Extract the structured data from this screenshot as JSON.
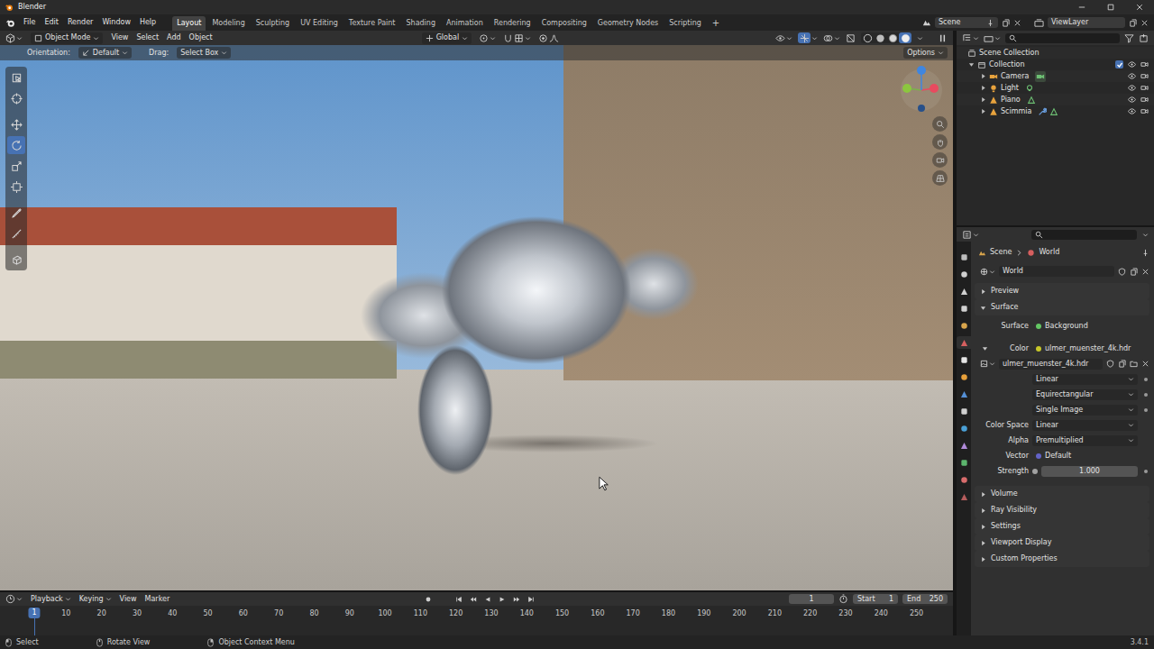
{
  "window": {
    "title": "Blender"
  },
  "topbar": {
    "menus": [
      "File",
      "Edit",
      "Render",
      "Window",
      "Help"
    ],
    "workspaces": [
      {
        "label": "Layout",
        "selected": true
      },
      {
        "label": "Modeling",
        "selected": false
      },
      {
        "label": "Sculpting",
        "selected": false
      },
      {
        "label": "UV Editing",
        "selected": false
      },
      {
        "label": "Texture Paint",
        "selected": false
      },
      {
        "label": "Shading",
        "selected": false
      },
      {
        "label": "Animation",
        "selected": false
      },
      {
        "label": "Rendering",
        "selected": false
      },
      {
        "label": "Compositing",
        "selected": false
      },
      {
        "label": "Geometry Nodes",
        "selected": false
      },
      {
        "label": "Scripting",
        "selected": false
      }
    ],
    "add_tab": "+",
    "scene": "Scene",
    "view_layer": "ViewLayer"
  },
  "viewport": {
    "mode": "Object Mode",
    "menus": [
      "View",
      "Select",
      "Add",
      "Object"
    ],
    "orientation": "Global",
    "gizmos_on": true,
    "shading_modes": [
      {
        "selected": false
      },
      {
        "selected": false
      },
      {
        "selected": false
      },
      {
        "selected": true
      }
    ],
    "tool_settings": {
      "orientation_label": "Orientation:",
      "orientation": "Default",
      "drag_label": "Drag:",
      "drag": "Select Box",
      "options": "Options"
    },
    "tools": [
      {
        "selected": false
      },
      {
        "selected": false
      },
      {
        "selected": false
      },
      {
        "selected": true
      },
      {
        "selected": false
      },
      {
        "selected": false
      },
      {
        "selected": false
      },
      {
        "selected": false
      },
      {
        "selected": false
      }
    ]
  },
  "outliner": {
    "root": "Scene Collection",
    "collection": {
      "name": "Collection",
      "checked": true,
      "expanded": true,
      "visible": true,
      "renderable": true
    },
    "items": [
      {
        "name": "Camera",
        "kind": "camera",
        "has_modifier": false,
        "visible": true,
        "renderable": true
      },
      {
        "name": "Light",
        "kind": "light",
        "has_modifier": false,
        "visible": true,
        "renderable": true
      },
      {
        "name": "Piano",
        "kind": "mesh",
        "has_modifier": false,
        "visible": true,
        "renderable": true
      },
      {
        "name": "Scimmia",
        "kind": "mesh",
        "has_modifier": true,
        "visible": true,
        "renderable": true
      }
    ]
  },
  "properties": {
    "tabs": [
      {
        "selected": false
      },
      {
        "selected": false
      },
      {
        "selected": false
      },
      {
        "selected": false
      },
      {
        "selected": false
      },
      {
        "selected": true
      },
      {
        "selected": false
      },
      {
        "selected": false
      },
      {
        "selected": false
      },
      {
        "selected": false
      },
      {
        "selected": false
      },
      {
        "selected": false
      },
      {
        "selected": false
      },
      {
        "selected": false
      },
      {
        "selected": false
      }
    ],
    "breadcrumb": [
      "Scene",
      "World"
    ],
    "world": "World",
    "sections": [
      {
        "label": "Preview",
        "expanded": false
      },
      {
        "label": "Surface",
        "expanded": true
      }
    ],
    "sockets_top": [
      {
        "label": "Surface",
        "value": "Background",
        "color": "#63c763",
        "expandable": false,
        "expanded": false
      },
      {
        "label": "Color",
        "value": "ulmer_muenster_4k.hdr",
        "color": "#c7c729",
        "expandable": true,
        "expanded": true
      }
    ],
    "image": "ulmer_muenster_4k.hdr",
    "image_options": [
      "Linear",
      "Equirectangular",
      "Single Image"
    ],
    "fields": [
      {
        "label": "Color Space",
        "value": "Linear"
      },
      {
        "label": "Alpha",
        "value": "Premultiplied"
      }
    ],
    "sockets_bottom": [
      {
        "label": "Vector",
        "value": "Default",
        "color": "#6363c7",
        "kind": "link"
      },
      {
        "label": "Strength",
        "value": "1.000",
        "color": "#a1a1a1",
        "kind": "number"
      }
    ],
    "more_sections": [
      {
        "label": "Volume",
        "expanded": false
      },
      {
        "label": "Ray Visibility",
        "expanded": false
      },
      {
        "label": "Settings",
        "expanded": false
      },
      {
        "label": "Viewport Display",
        "expanded": false
      },
      {
        "label": "Custom Properties",
        "expanded": false
      }
    ]
  },
  "timeline": {
    "menus": [
      "Playback",
      "Keying",
      "View",
      "Marker"
    ],
    "current_frame": "1",
    "start_label": "Start",
    "start": "1",
    "end_label": "End",
    "end": "250",
    "playhead": "1",
    "ticks": [
      "10",
      "20",
      "30",
      "40",
      "50",
      "60",
      "70",
      "80",
      "90",
      "100",
      "110",
      "120",
      "130",
      "140",
      "150",
      "160",
      "170",
      "180",
      "190",
      "200",
      "210",
      "220",
      "230",
      "240",
      "250"
    ]
  },
  "status_bar": {
    "hints": [
      "Select",
      "Rotate View",
      "Object Context Menu"
    ],
    "version": "3.4.1"
  }
}
